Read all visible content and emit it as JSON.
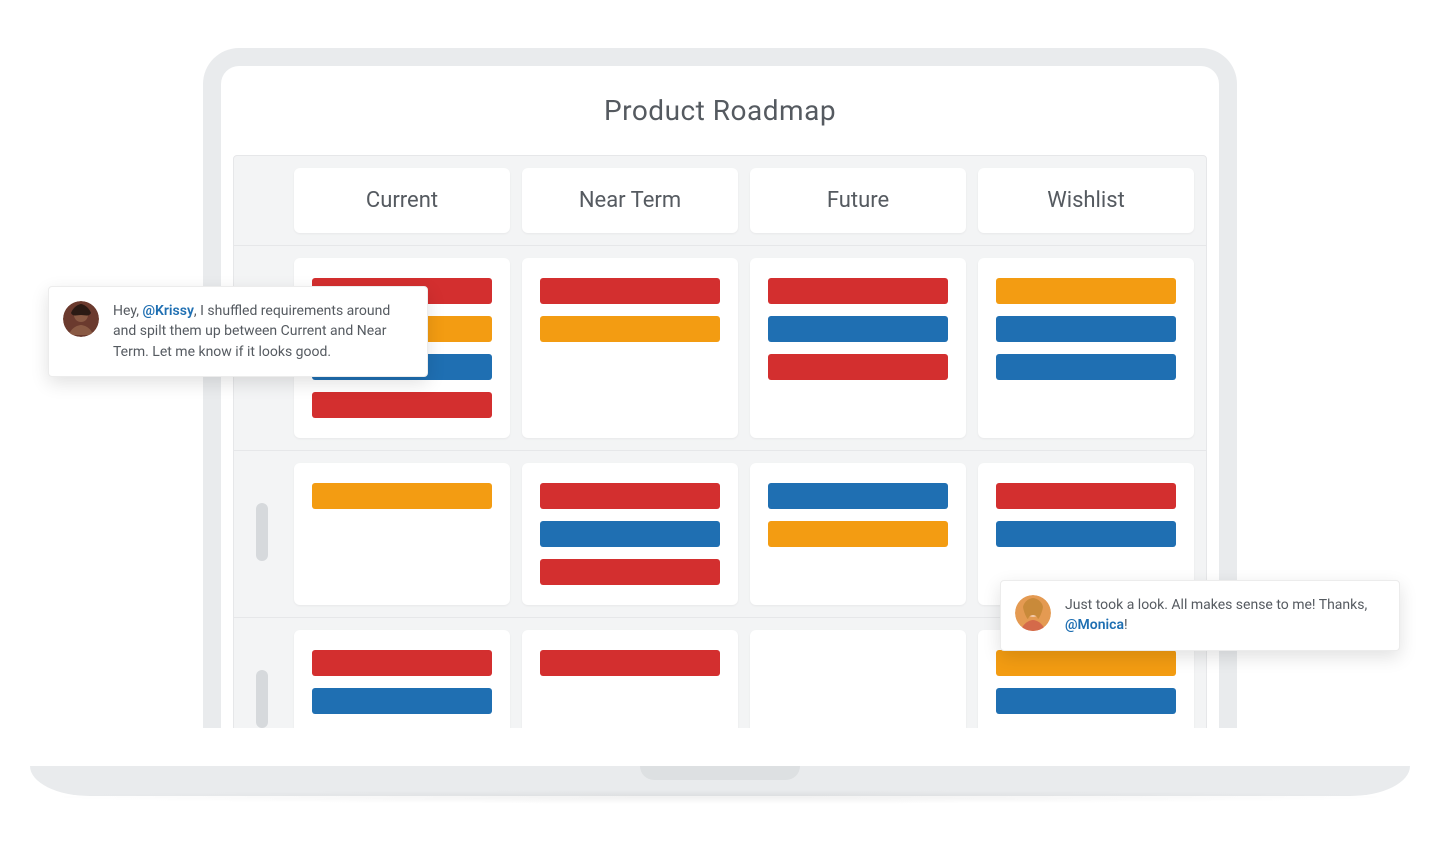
{
  "page": {
    "title": "Product Roadmap"
  },
  "columns": [
    "Current",
    "Near Term",
    "Future",
    "Wishlist"
  ],
  "workspaces": [
    {
      "cells": [
        [
          "red",
          "orange",
          "blue",
          "red"
        ],
        [
          "red",
          "orange"
        ],
        [
          "red",
          "blue",
          "red"
        ],
        [
          "orange",
          "blue",
          "blue"
        ]
      ]
    },
    {
      "cells": [
        [
          "orange"
        ],
        [
          "red",
          "blue",
          "red"
        ],
        [
          "blue",
          "orange"
        ],
        [
          "red",
          "blue"
        ]
      ]
    },
    {
      "cells": [
        [
          "red",
          "blue"
        ],
        [
          "red"
        ],
        [],
        [
          "orange",
          "blue"
        ]
      ]
    }
  ],
  "comments": {
    "left": {
      "text_before": "Hey, ",
      "mention": "@Krissy",
      "text_after": ", I shuffled requirements around and spilt them up between Current and Near Term. Let me know if it looks good."
    },
    "right": {
      "text_before": "Just took a look. All makes sense to me! Thanks, ",
      "mention": "@Monica",
      "text_after": "!"
    }
  },
  "colors": {
    "red": "#d32f2f",
    "orange": "#f39c12",
    "blue": "#1f6fb2"
  }
}
